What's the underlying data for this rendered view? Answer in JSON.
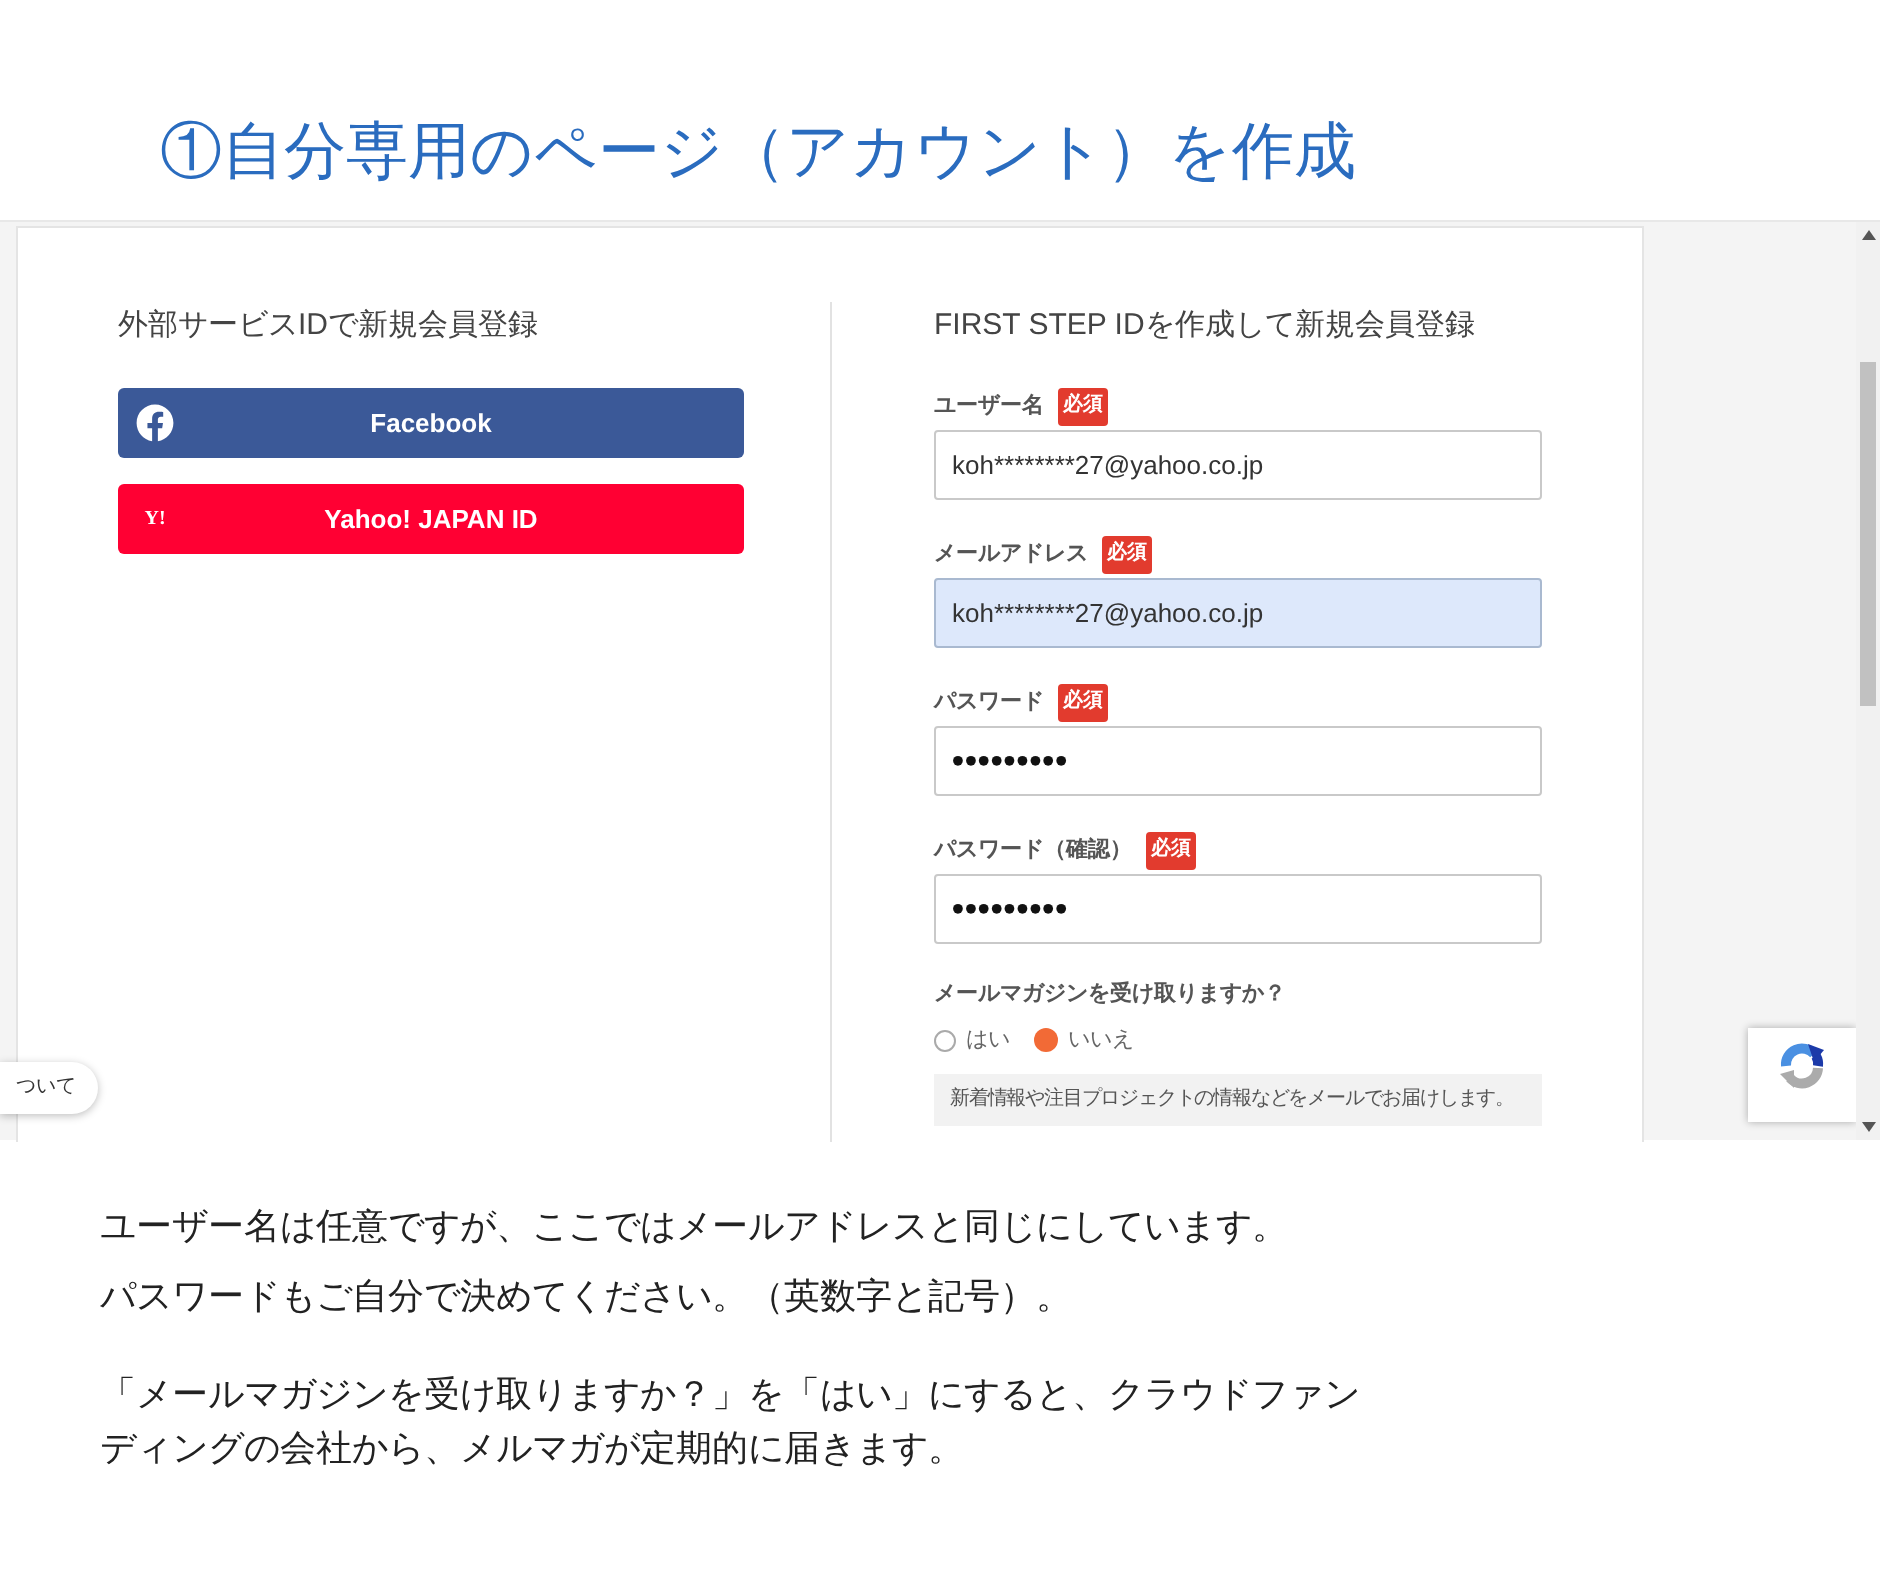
{
  "page_title": "①自分専用のページ（アカウント）を作成",
  "screenshot": {
    "external_signup": {
      "heading": "外部サービスIDで新規会員登録",
      "buttons": [
        {
          "kind": "facebook",
          "label": "Facebook"
        },
        {
          "kind": "yahoo",
          "logo": "Y!",
          "label": "Yahoo! JAPAN ID"
        }
      ]
    },
    "signup_form": {
      "heading": "FIRST STEP IDを作成して新規会員登録",
      "fields": [
        {
          "kind": "text",
          "label": "ユーザー名",
          "badge": "必須",
          "value": "koh********27@yahoo.co.jp",
          "autofilled": false
        },
        {
          "kind": "text",
          "label": "メールアドレス",
          "badge": "必須",
          "value": "koh********27@yahoo.co.jp",
          "autofilled": true
        },
        {
          "kind": "password",
          "label": "パスワード",
          "badge": "必須",
          "value": "•••••••••",
          "autofilled": false
        },
        {
          "kind": "password",
          "label": "パスワード（確認）",
          "badge": "必須",
          "value": "•••••••••",
          "autofilled": false
        }
      ],
      "newsletter": {
        "question": "メールマガジンを受け取りますか？",
        "options": [
          {
            "label": "はい",
            "selected": false
          },
          {
            "label": "いいえ",
            "selected": true
          }
        ],
        "note": "新着情報や注目プロジェクトの情報などをメールでお届けします。"
      }
    },
    "side_tab": {
      "label": "ついて"
    }
  },
  "instruction_groups": [
    {
      "lines": [
        "ユーザー名は任意ですが、ここではメールアドレスと同じにしています。",
        "パスワードもご自分で決めてください。（英数字と記号）。"
      ]
    },
    {
      "lines": [
        "「メールマガジンを受け取りますか？」を「はい」にすると、クラウドファンディングの会社から、メルマガが定期的に届きます。"
      ]
    }
  ]
}
